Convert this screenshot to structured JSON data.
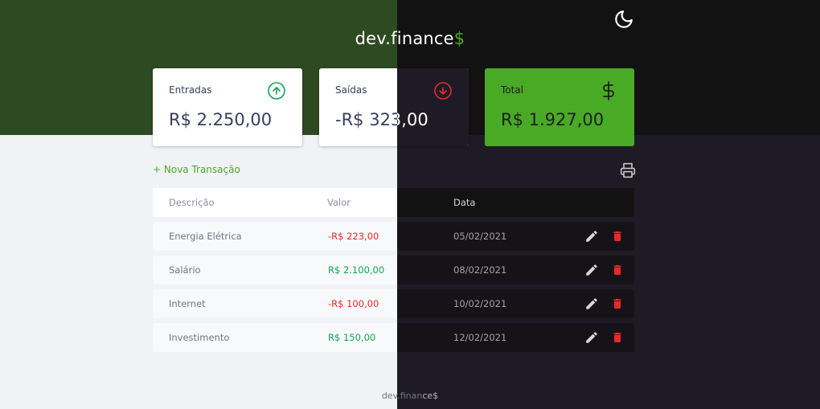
{
  "header": {
    "logo_prefix": "dev",
    "logo_dot": ".",
    "logo_main": "finance",
    "logo_accent": "$",
    "theme_icon": "moon-icon"
  },
  "cards": {
    "income": {
      "title": "Entradas",
      "value": "R$ 2.250,00",
      "icon": "arrow-up-circle-icon"
    },
    "expense": {
      "title": "Saídas",
      "value": "-R$ 323,00",
      "icon": "arrow-down-circle-icon"
    },
    "total": {
      "title": "Total",
      "value": "R$ 1.927,00",
      "icon": "dollar-icon"
    }
  },
  "actions": {
    "new_transaction": "+ Nova Transação",
    "print_icon": "printer-icon"
  },
  "table": {
    "headers": {
      "description": "Descrição",
      "value": "Valor",
      "date": "Data"
    },
    "rows": [
      {
        "description": "Energia Elétrica",
        "value": "-R$ 223,00",
        "type": "expense",
        "date": "05/02/2021"
      },
      {
        "description": "Salário",
        "value": "R$ 2.100,00",
        "type": "income",
        "date": "08/02/2021"
      },
      {
        "description": "Internet",
        "value": "-R$ 100,00",
        "type": "expense",
        "date": "10/02/2021"
      },
      {
        "description": "Investimento",
        "value": "R$ 150,00",
        "type": "income",
        "date": "12/02/2021"
      }
    ]
  },
  "footer": {
    "left_text": "dev.finan",
    "right_text": "ce$"
  },
  "colors": {
    "header_green": "#2d4a22",
    "accent_green": "#49aa26",
    "dark_bg": "#121212",
    "dark_body": "#1f1b26",
    "light_body": "#f0f2f5",
    "expense_red": "#e92929",
    "income_green": "#12a454"
  }
}
